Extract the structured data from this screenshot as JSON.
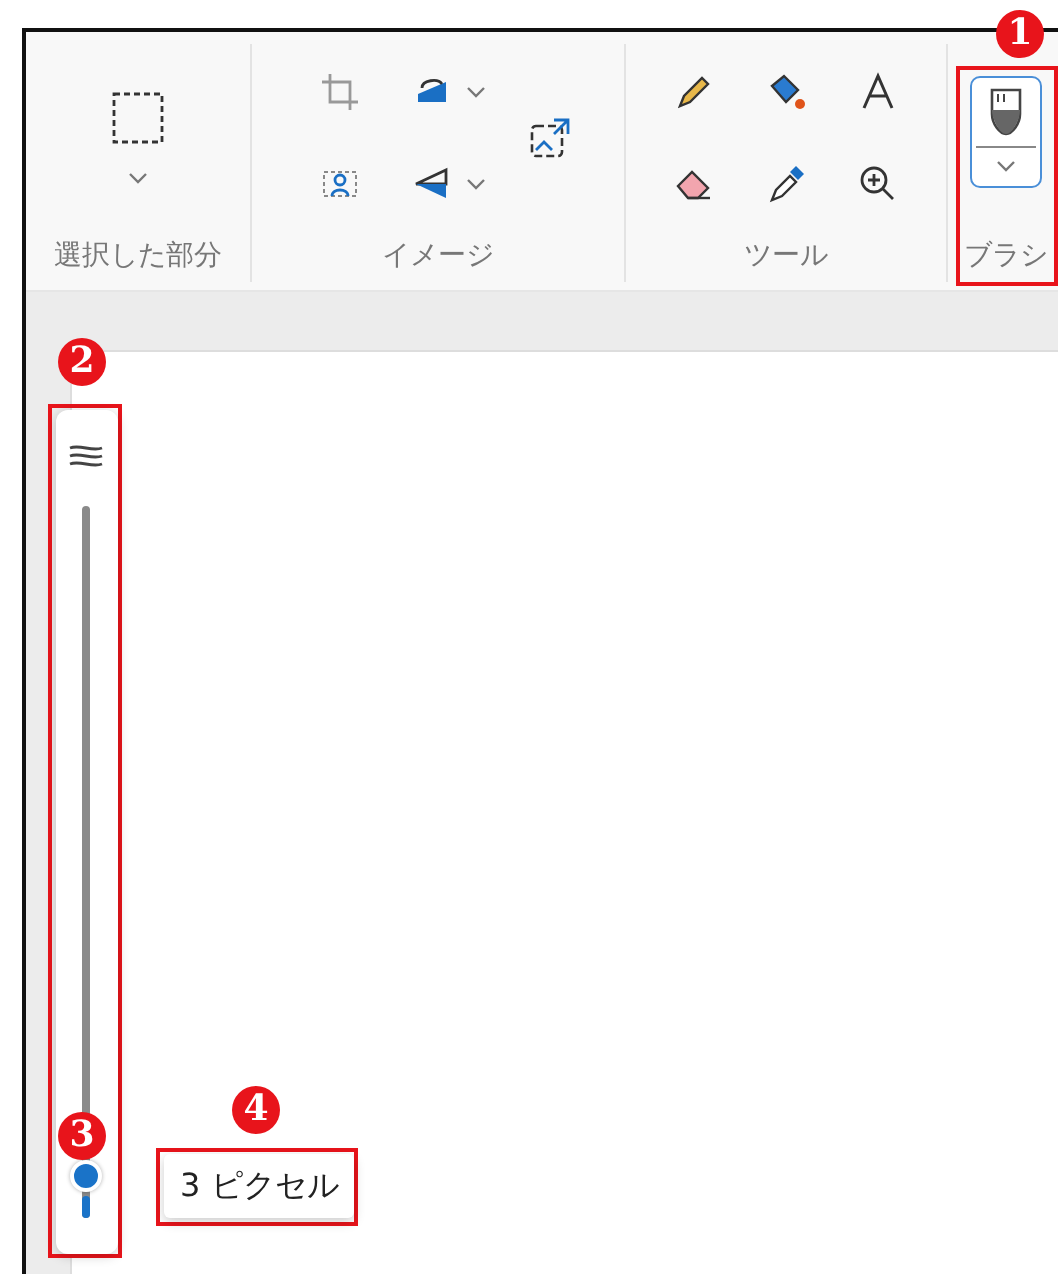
{
  "ribbon": {
    "groups": [
      {
        "label": "選択した部分",
        "kind": "selection"
      },
      {
        "label": "イメージ",
        "kind": "image"
      },
      {
        "label": "ツール",
        "kind": "tools"
      },
      {
        "label": "ブラシ",
        "kind": "brush",
        "selected": true
      }
    ]
  },
  "brush_size": {
    "level": 0.03,
    "tooltip": "3 ピクセル"
  },
  "annotations": [
    {
      "number": "1",
      "kind": "brush"
    },
    {
      "number": "2",
      "kind": "slider"
    },
    {
      "number": "3",
      "kind": "thumb"
    },
    {
      "number": "4",
      "kind": "tooltip"
    }
  ]
}
